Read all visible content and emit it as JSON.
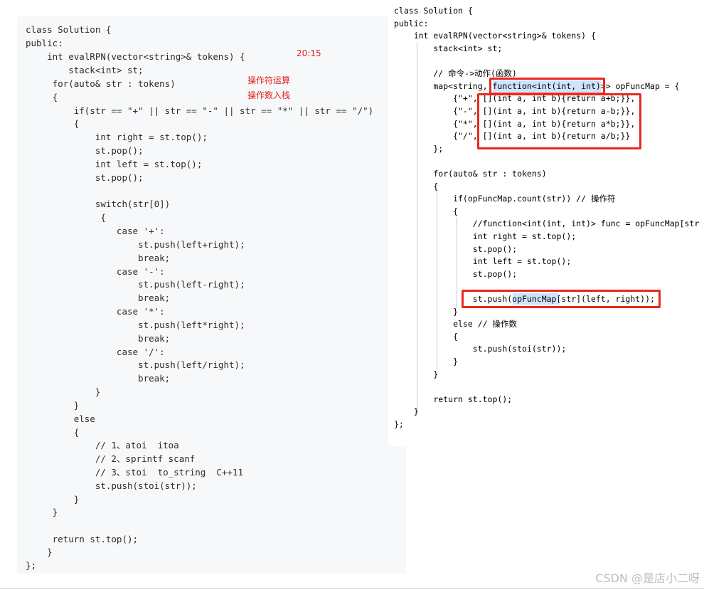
{
  "left_code": [
    "class Solution {",
    "public:",
    "    int evalRPN(vector<string>& tokens) {",
    "        stack<int> st;",
    "     for(auto& str : tokens)",
    "     {",
    "         if(str == \"+\" || str == \"-\" || str == \"*\" || str == \"/\")",
    "         {",
    "             int right = st.top();",
    "             st.pop();",
    "             int left = st.top();",
    "             st.pop();",
    "",
    "             switch(str[0])",
    "              {",
    "                 case '+':",
    "                     st.push(left+right);",
    "                     break;",
    "                 case '-':",
    "                     st.push(left-right);",
    "                     break;",
    "                 case '*':",
    "                     st.push(left*right);",
    "                     break;",
    "                 case '/':",
    "                     st.push(left/right);",
    "                     break;",
    "             }",
    "         }",
    "         else",
    "         {",
    "             // 1、atoi  itoa",
    "             // 2、sprintf scanf",
    "             // 3、stoi  to_string  C++11",
    "             st.push(stoi(str));",
    "         }",
    "     }",
    "",
    "     return st.top();",
    "    }",
    "};"
  ],
  "right_code": [
    "class Solution {",
    "public:",
    "    int evalRPN(vector<string>& tokens) {",
    "        stack<int> st;",
    "",
    "        // 命令->动作(函数)",
    "        map<string, function<int(int, int)>> opFuncMap = {",
    "            {\"+\", [](int a, int b){return a+b;}},",
    "            {\"-\", [](int a, int b){return a-b;}},",
    "            {\"*\", [](int a, int b){return a*b;}},",
    "            {\"/\", [](int a, int b){return a/b;}}",
    "        };",
    "",
    "        for(auto& str : tokens)",
    "        {",
    "            if(opFuncMap.count(str)) // 操作符",
    "            {",
    "                //function<int(int, int)> func = opFuncMap[str",
    "                int right = st.top();",
    "                st.pop();",
    "                int left = st.top();",
    "                st.pop();",
    "",
    "                st.push(opFuncMap[str](left, right));",
    "            }",
    "            else // 操作数",
    "            {",
    "                st.push(stoi(str));",
    "            }",
    "        }",
    "",
    "        return st.top();",
    "    }",
    "};"
  ],
  "annotations": {
    "time": "20:15",
    "note_operator": "操作符运算",
    "note_operand": "操作数入栈"
  },
  "watermark": "CSDN @是店小二呀",
  "colors": {
    "highlight_box": "#e8281f",
    "annotation_text": "#e02020",
    "left_panel_bg": "#f7f8fa"
  }
}
